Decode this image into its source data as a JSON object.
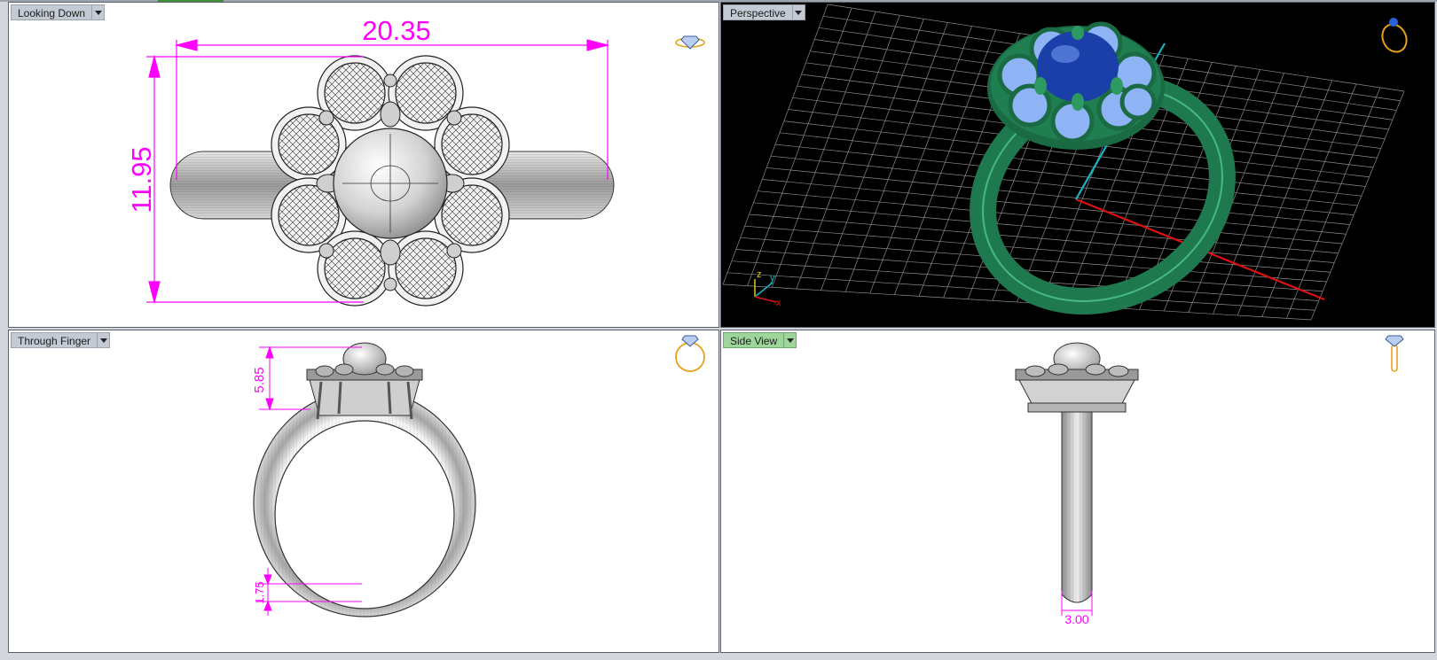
{
  "viewports": {
    "top_left": {
      "label": "Looking Down",
      "dims": {
        "width": "20.35",
        "height": "11.95"
      }
    },
    "top_right": {
      "label": "Perspective",
      "axes": {
        "z": "z",
        "y": "y",
        "x": "x"
      }
    },
    "bottom_left": {
      "label": "Through Finger",
      "dims": {
        "head_height": "5.85",
        "shank_thickness": "1.75"
      }
    },
    "bottom_right": {
      "label": "Side View",
      "dims": {
        "shank_width": "3.00"
      }
    }
  },
  "colors": {
    "dimension": "#ff00ff",
    "ring_green": "#1e7a4e",
    "stone_blue": "#1a3fa8",
    "accent_stone": "#8fb4f5",
    "grid": "#8a8a8a",
    "active_tab": "#9ed59a"
  },
  "icons": [
    "dropdown-arrow-icon",
    "ring-orientation-icon"
  ]
}
